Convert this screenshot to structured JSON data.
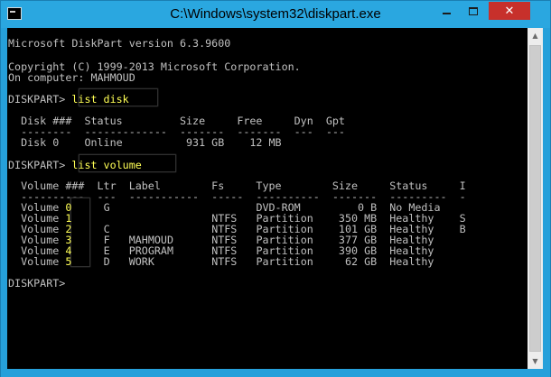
{
  "window": {
    "title": "C:\\Windows\\system32\\diskpart.exe",
    "close_glyph": "✕",
    "scroll_up_glyph": "▲",
    "scroll_down_glyph": "▼",
    "accent_color": "#2aa7e0",
    "close_color": "#c7302b"
  },
  "console": {
    "version": "Microsoft DiskPart version 6.3.9600",
    "copyright": "Copyright (C) 1999-2013 Microsoft Corporation.",
    "computer": "On computer: MAHMOUD",
    "prompt": "DISKPART> ",
    "prompt_final": "DISKPART>",
    "cmd1": "list disk",
    "cmd2": "list volume",
    "disk_header": "  Disk ###  Status         Size     Free     Dyn  Gpt",
    "disk_rule": "  --------  -------------  -------  -------  ---  ---",
    "disk_rows": [
      "  Disk 0    Online          931 GB    12 MB"
    ],
    "vol_header": "  Volume ###  Ltr  Label        Fs     Type        Size     Status     I",
    "vol_rule": "  ----------  ---  -----------  -----  ----------  -------  ---------  -",
    "volumes": [
      {
        "prefix": "  Volume ",
        "num": "0",
        "rest": "     G                       DVD-ROM         0 B  No Media"
      },
      {
        "prefix": "  Volume ",
        "num": "1",
        "rest": "                      NTFS   Partition    350 MB  Healthy    S"
      },
      {
        "prefix": "  Volume ",
        "num": "2",
        "rest": "     C                NTFS   Partition    101 GB  Healthy    B"
      },
      {
        "prefix": "  Volume ",
        "num": "3",
        "rest": "     F   MAHMOUD      NTFS   Partition    377 GB  Healthy"
      },
      {
        "prefix": "  Volume ",
        "num": "4",
        "rest": "     E   PROGRAM      NTFS   Partition    390 GB  Healthy"
      },
      {
        "prefix": "  Volume ",
        "num": "5",
        "rest": "     D   WORK         NTFS   Partition     62 GB  Healthy"
      }
    ]
  }
}
